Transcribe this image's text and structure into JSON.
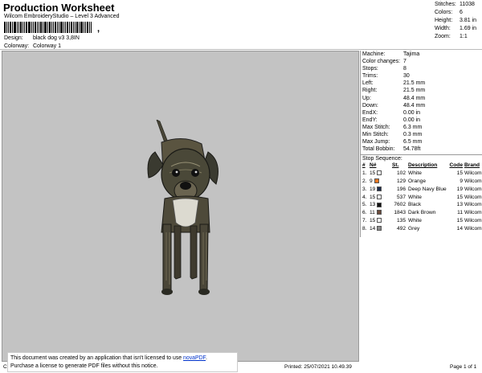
{
  "header": {
    "title": "Production Worksheet",
    "subtitle": "Wilcom EmbroideryStudio – Level 3 Advanced",
    "barcode_tail": ",",
    "design_label": "Design:",
    "design_value": "black dog v3 3,8IN",
    "colorway_label": "Colorway:",
    "colorway_value": "Colorway 1"
  },
  "stats": [
    {
      "label": "Stitches:",
      "value": "11038"
    },
    {
      "label": "Colors:",
      "value": "6"
    },
    {
      "label": "Height:",
      "value": "3.81 in"
    },
    {
      "label": "Width:",
      "value": "1.69 in"
    },
    {
      "label": "Zoom:",
      "value": "1:1"
    }
  ],
  "machine_info": [
    {
      "label": "Machine:",
      "value": "Tajima"
    },
    {
      "label": "Color changes:",
      "value": "7"
    },
    {
      "label": "Stops:",
      "value": "8"
    },
    {
      "label": "Trims:",
      "value": "30"
    },
    {
      "label": "Left:",
      "value": "21.5 mm"
    },
    {
      "label": "Right:",
      "value": "21.5 mm"
    },
    {
      "label": "Up:",
      "value": "48.4 mm"
    },
    {
      "label": "Down:",
      "value": "48.4 mm"
    },
    {
      "label": "EndX:",
      "value": "0.00 in"
    },
    {
      "label": "EndY:",
      "value": "0.00 in"
    },
    {
      "label": "Max Stitch:",
      "value": "6.3 mm"
    },
    {
      "label": "Min Stitch:",
      "value": "0.3 mm"
    },
    {
      "label": "Max Jump:",
      "value": "6.5 mm"
    },
    {
      "label": "Total Bobbin:",
      "value": "54.78ft"
    }
  ],
  "stop_sequence": {
    "title": "Stop Sequence:",
    "columns": [
      "#",
      "N#",
      "St.",
      "Description",
      "Code",
      "Brand"
    ],
    "rows": [
      {
        "num": "1.",
        "n": "15",
        "color": "#ffffff",
        "st": "102",
        "desc": "White",
        "code": "15",
        "brand": "Wilcom"
      },
      {
        "num": "2.",
        "n": "9",
        "color": "#e87722",
        "st": "129",
        "desc": "Orange",
        "code": "9",
        "brand": "Wilcom"
      },
      {
        "num": "3.",
        "n": "19",
        "color": "#1c2a4a",
        "st": "196",
        "desc": "Deep Navy Blue",
        "code": "19",
        "brand": "Wilcom"
      },
      {
        "num": "4.",
        "n": "15",
        "color": "#ffffff",
        "st": "537",
        "desc": "White",
        "code": "15",
        "brand": "Wilcom"
      },
      {
        "num": "5.",
        "n": "13",
        "color": "#111111",
        "st": "7602",
        "desc": "Black",
        "code": "13",
        "brand": "Wilcom"
      },
      {
        "num": "6.",
        "n": "11",
        "color": "#6b4a3a",
        "st": "1843",
        "desc": "Dark Brown",
        "code": "11",
        "brand": "Wilcom"
      },
      {
        "num": "7.",
        "n": "15",
        "color": "#ffffff",
        "st": "135",
        "desc": "White",
        "code": "15",
        "brand": "Wilcom"
      },
      {
        "num": "8.",
        "n": "14",
        "color": "#8a8a8a",
        "st": "492",
        "desc": "Grey",
        "code": "14",
        "brand": "Wilcom"
      }
    ]
  },
  "footer": {
    "left": "Cr",
    "printed": "Printed: 25/07/2021 10.49.39",
    "page": "Page 1 of 1"
  },
  "notice": {
    "line1_prefix": "This document was created by an application that isn't licensed to use ",
    "link": "novaPDF",
    "line1_suffix": ".",
    "line2": "Purchase a license to generate PDF files without this notice."
  },
  "colors": {
    "canvas_bg": "#c3c3c3",
    "dog_dark": "#3a3a32",
    "dog_light": "#8a8468",
    "link": "#0033cc"
  }
}
